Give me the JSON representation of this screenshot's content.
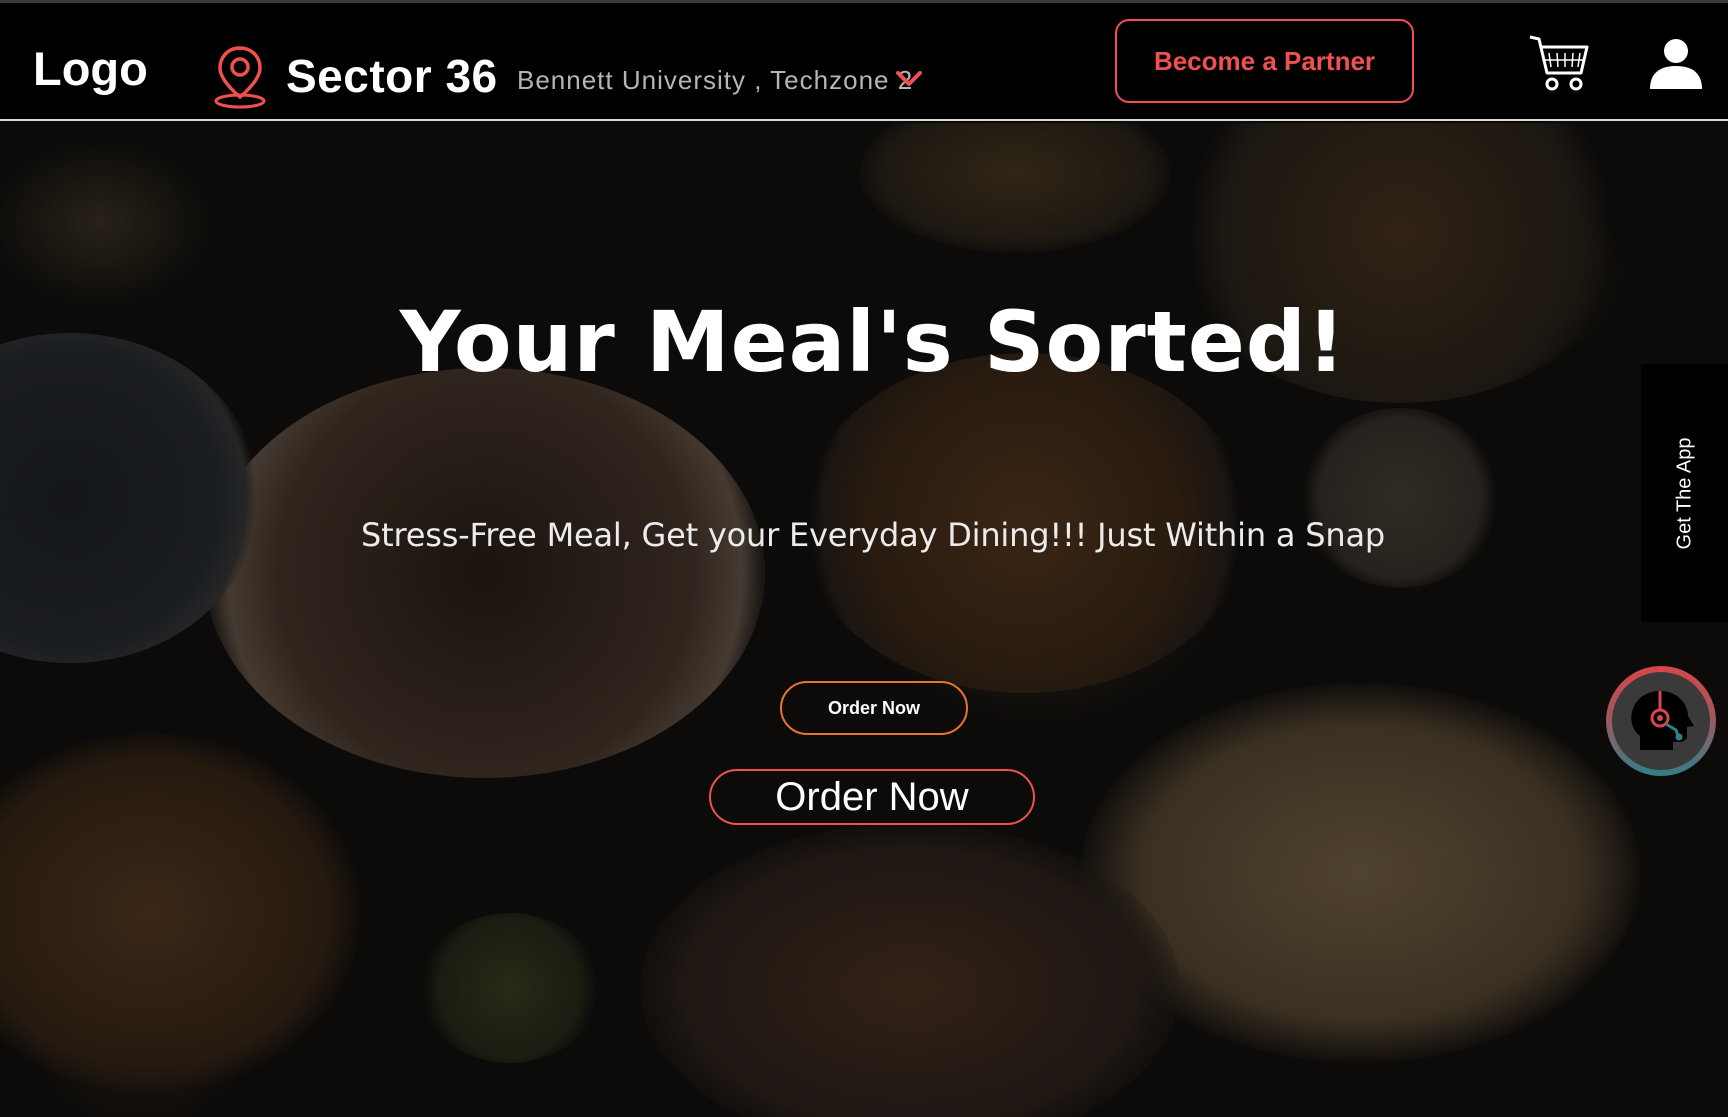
{
  "header": {
    "logo": "Logo",
    "location_title": "Sector 36",
    "location_address": "Bennett University , Techzone 2",
    "partner_button": "Become a Partner"
  },
  "hero": {
    "title": "Your Meal's Sorted!",
    "subtitle": "Stress-Free Meal, Get your Everyday Dining!!! Just Within a Snap",
    "order_small": "Order Now",
    "order_big": "Order Now"
  },
  "side": {
    "get_app": "Get The App"
  },
  "icons": {
    "location": "map-pin-icon",
    "dropdown": "chevron-down-icon",
    "cart": "cart-icon",
    "user": "user-icon",
    "support": "support-agent-icon"
  },
  "colors": {
    "accent": "#f0504f",
    "accent_orange": "#e8742e",
    "navbar_bg": "#000000"
  }
}
